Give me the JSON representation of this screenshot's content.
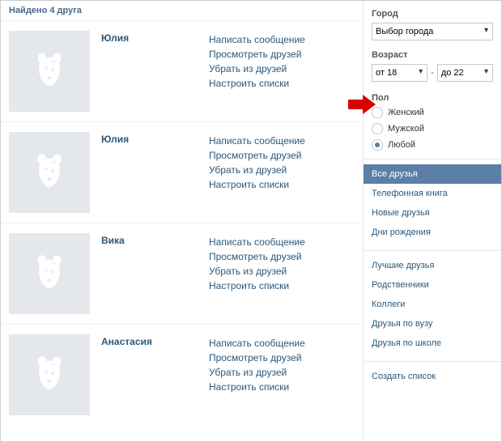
{
  "header": {
    "title": "Найдено 4 друга"
  },
  "friends": [
    {
      "name": "Юлия"
    },
    {
      "name": "Юлия"
    },
    {
      "name": "Вика"
    },
    {
      "name": "Анастасия"
    }
  ],
  "actions": {
    "write": "Написать сообщение",
    "view": "Просмотреть друзей",
    "remove": "Убрать из друзей",
    "lists": "Настроить списки"
  },
  "filters": {
    "city_label": "Город",
    "city_placeholder": "Выбор города",
    "age_label": "Возраст",
    "age_from": "от 18",
    "age_to": "до 22",
    "age_dash": "-",
    "gender_label": "Пол",
    "gender_female": "Женский",
    "gender_male": "Мужской",
    "gender_any": "Любой"
  },
  "lists": {
    "all": "Все друзья",
    "phonebook": "Телефонная книга",
    "new": "Новые друзья",
    "birthdays": "Дни рождения",
    "best": "Лучшие друзья",
    "family": "Родственники",
    "colleagues": "Коллеги",
    "university": "Друзья по вузу",
    "school": "Друзья по школе",
    "create": "Создать список"
  }
}
